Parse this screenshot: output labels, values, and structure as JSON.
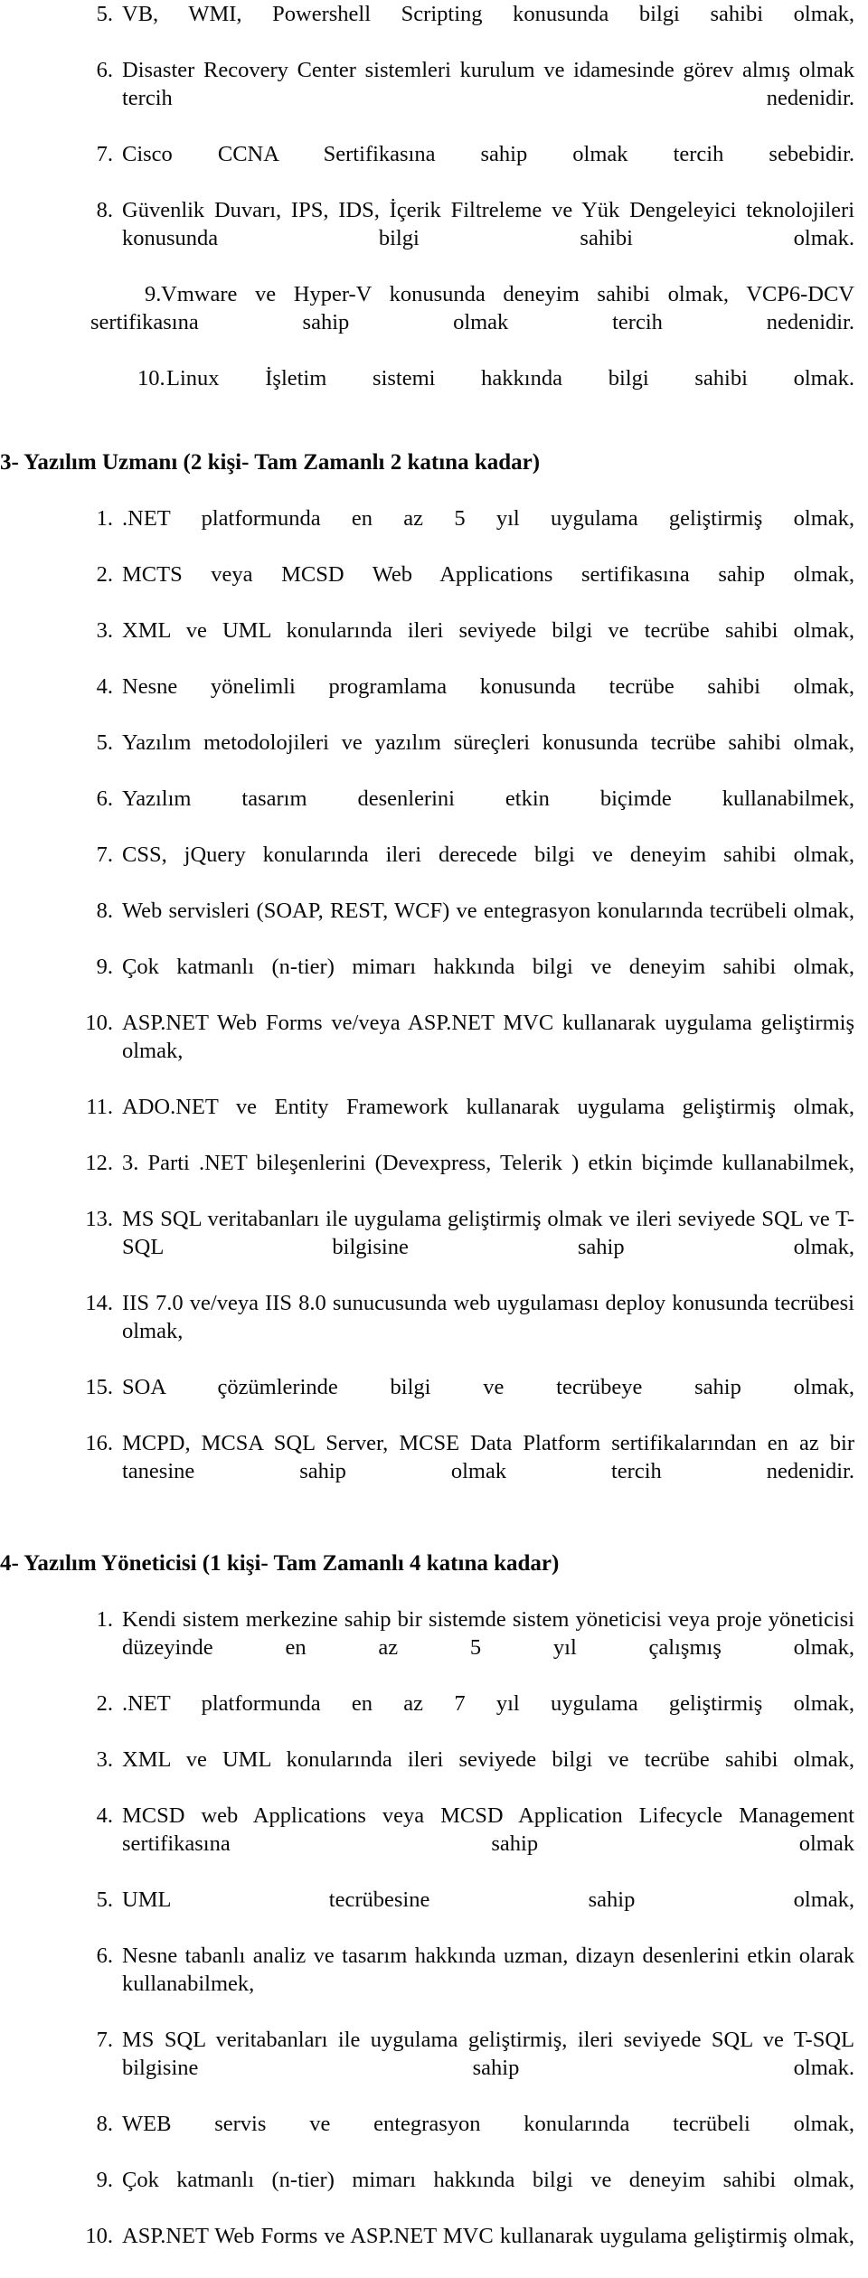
{
  "document": {
    "language": "tr",
    "sections": [
      {
        "id": "section-2-continued",
        "heading": "",
        "items_main": [
          {
            "num": "5.",
            "text": "VB, WMI, Powershell Scripting konusunda bilgi sahibi olmak,"
          },
          {
            "num": "6.",
            "text": "Disaster Recovery Center sistemleri kurulum ve idamesinde görev almış olmak tercih nedenidir."
          },
          {
            "num": "7.",
            "text": "Cisco CCNA Sertifikasına sahip olmak tercih sebebidir."
          },
          {
            "num": "8.",
            "text": "Güvenlik Duvarı, IPS, IDS, İçerik Filtreleme ve Yük Dengeleyici teknolojileri konusunda bilgi sahibi olmak."
          }
        ],
        "items_indented": [
          {
            "num": "9.",
            "text": "Vmware ve Hyper-V konusunda deneyim sahibi olmak, VCP6-DCV sertifikasına sahip olmak tercih nedenidir."
          },
          {
            "num": "10.",
            "text": "Linux İşletim sistemi hakkında bilgi sahibi olmak."
          }
        ]
      },
      {
        "id": "section-3",
        "heading": "3- Yazılım Uzmanı (2 kişi- Tam Zamanlı 2 katına kadar)",
        "items": [
          {
            "num": "1.",
            "text": ".NET platformunda en az 5 yıl uygulama geliştirmiş olmak,"
          },
          {
            "num": "2.",
            "text": "MCTS veya MCSD Web Applications sertifikasına sahip olmak,"
          },
          {
            "num": "3.",
            "text": "XML ve UML konularında ileri seviyede bilgi ve tecrübe sahibi olmak,"
          },
          {
            "num": "4.",
            "text": "Nesne yönelimli programlama konusunda tecrübe sahibi olmak,"
          },
          {
            "num": "5.",
            "text": "Yazılım metodolojileri ve yazılım süreçleri konusunda tecrübe sahibi olmak,"
          },
          {
            "num": "6.",
            "text": "Yazılım tasarım desenlerini etkin biçimde kullanabilmek,"
          },
          {
            "num": "7.",
            "text": "CSS, jQuery konularında ileri derecede bilgi ve deneyim sahibi olmak,"
          },
          {
            "num": "8.",
            "text": "Web servisleri (SOAP, REST, WCF) ve entegrasyon konularında tecrübeli olmak,"
          },
          {
            "num": "9.",
            "text": "Çok katmanlı (n-tier) mimarı hakkında bilgi ve deneyim sahibi olmak,"
          },
          {
            "num": "10.",
            "text": "ASP.NET Web Forms ve/veya ASP.NET MVC kullanarak uygulama geliştirmiş olmak,"
          },
          {
            "num": "11.",
            "text": "ADO.NET ve Entity Framework kullanarak uygulama geliştirmiş olmak,"
          },
          {
            "num": "12.",
            "text": "3. Parti .NET bileşenlerini (Devexpress, Telerik ) etkin biçimde kullanabilmek,"
          },
          {
            "num": "13.",
            "text": "MS SQL veritabanları ile uygulama geliştirmiş olmak ve ileri seviyede SQL ve T-SQL bilgisine sahip olmak,"
          },
          {
            "num": "14.",
            "text": "IIS 7.0 ve/veya IIS 8.0 sunucusunda web uygulaması deploy konusunda tecrübesi olmak,"
          },
          {
            "num": "15.",
            "text": "SOA çözümlerinde bilgi ve tecrübeye sahip olmak,"
          },
          {
            "num": "16.",
            "text": "MCPD, MCSA SQL Server, MCSE Data Platform sertifikalarından en az bir tanesine sahip olmak tercih nedenidir."
          }
        ]
      },
      {
        "id": "section-4",
        "heading": "4- Yazılım Yöneticisi (1 kişi- Tam Zamanlı 4 katına kadar)",
        "items": [
          {
            "num": "1.",
            "text": "Kendi sistem merkezine sahip bir sistemde sistem yöneticisi veya proje yöneticisi düzeyinde en az 5 yıl çalışmış olmak,"
          },
          {
            "num": "2.",
            "text": ".NET platformunda en az 7 yıl uygulama geliştirmiş olmak,"
          },
          {
            "num": "3.",
            "text": "XML ve UML konularında ileri seviyede bilgi ve tecrübe sahibi olmak,"
          },
          {
            "num": "4.",
            "text": "MCSD web Applications veya MCSD Application Lifecycle Management sertifikasına sahip olmak"
          },
          {
            "num": "5.",
            "text": "UML tecrübesine sahip olmak,"
          },
          {
            "num": "6.",
            "text": "Nesne tabanlı analiz ve tasarım hakkında uzman, dizayn desenlerini etkin olarak kullanabilmek,"
          },
          {
            "num": "7.",
            "text": "MS SQL veritabanları ile uygulama geliştirmiş, ileri seviyede SQL ve T-SQL bilgisine sahip olmak."
          },
          {
            "num": "8.",
            "text": "WEB servis ve entegrasyon konularında tecrübeli olmak,"
          },
          {
            "num": "9.",
            "text": "Çok katmanlı (n-tier) mimarı hakkında bilgi ve deneyim sahibi olmak,"
          },
          {
            "num": "10.",
            "text": "ASP.NET Web Forms ve ASP.NET MVC kullanarak uygulama geliştirmiş olmak,"
          }
        ]
      }
    ]
  }
}
